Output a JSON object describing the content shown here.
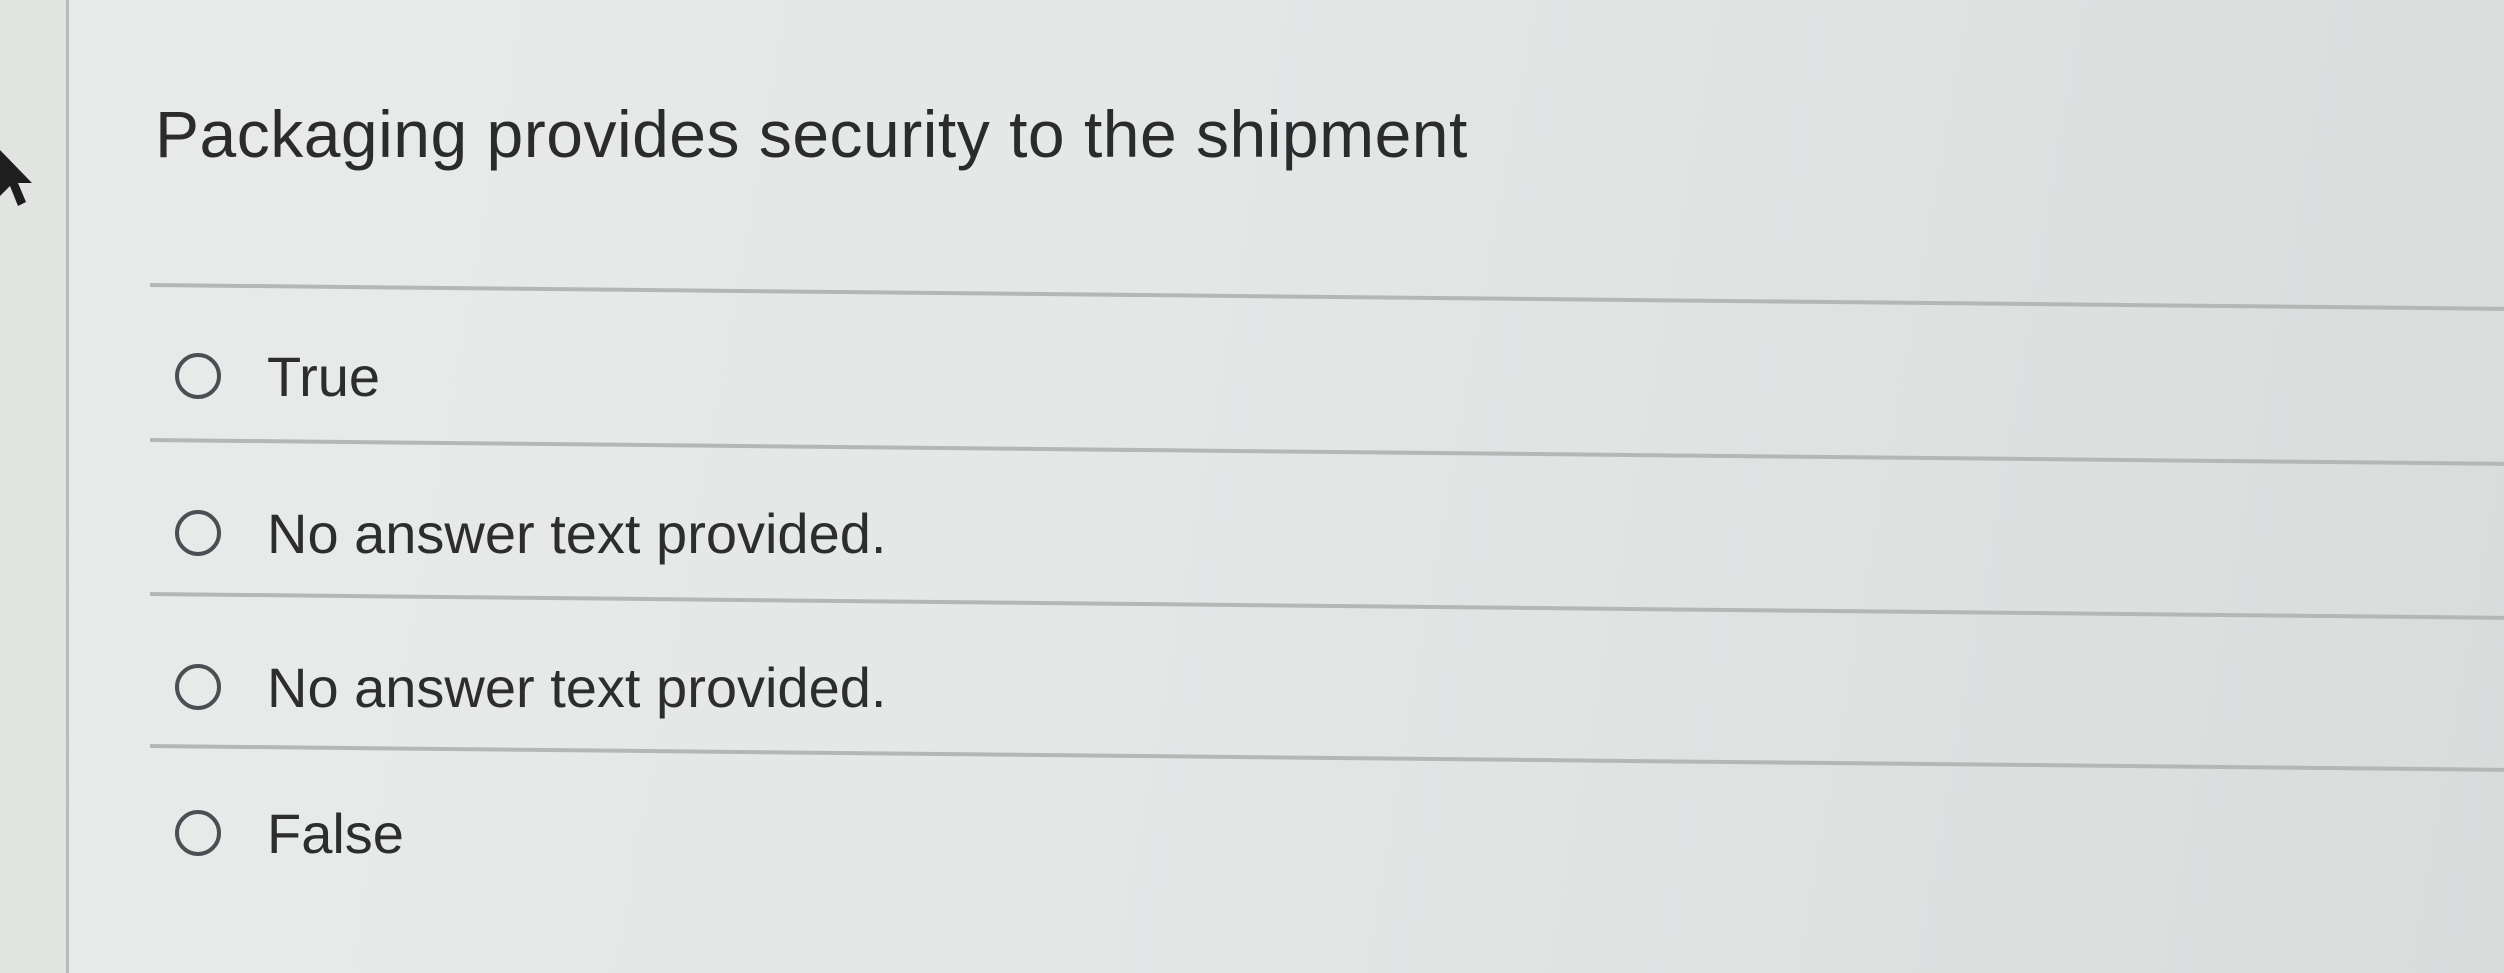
{
  "question": {
    "title": "Packaging provides security to the shipment"
  },
  "options": [
    {
      "label": "True",
      "selected": false
    },
    {
      "label": "No answer text provided.",
      "selected": false
    },
    {
      "label": "No answer text provided.",
      "selected": false
    },
    {
      "label": "False",
      "selected": false
    }
  ],
  "icons": {
    "pointer": "mouse-pointer-icon",
    "radio": "radio-unselected-icon"
  },
  "colors": {
    "background": "#e4e7e5",
    "text": "#2d2d2f",
    "divider": "#b3b7b6",
    "radio_border": "#4b4f53"
  }
}
